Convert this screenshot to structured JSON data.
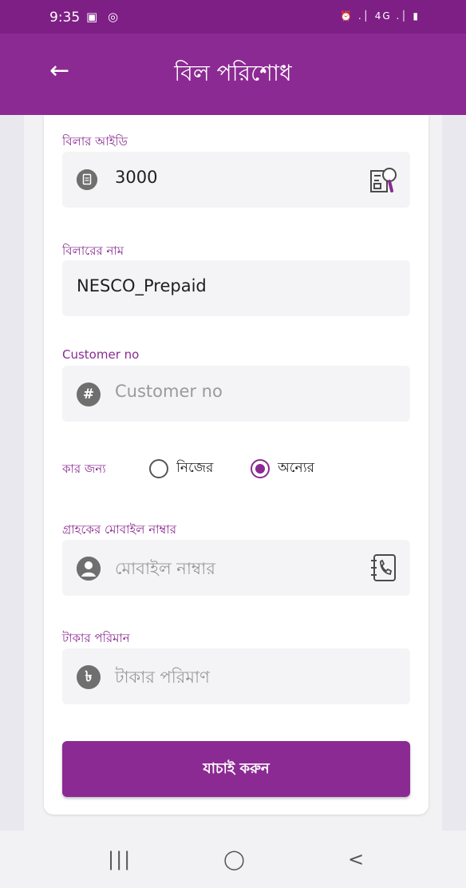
{
  "status": {
    "time": "9:35",
    "left_icons": "▣ ◎",
    "right_icons": "⏰ .│ 4G .│ ▮"
  },
  "appbar": {
    "back_icon": "arrow-left-icon",
    "title": "বিল পরিশোধ"
  },
  "form": {
    "biller_id": {
      "label": "বিলার আইডি",
      "value": "3000",
      "lead_icon": "document-icon",
      "action_icon": "search-document-icon"
    },
    "biller_name": {
      "label": "বিলারের নাম",
      "value": "NESCO_Prepaid"
    },
    "customer_no": {
      "label": "Customer no",
      "placeholder": "Customer no",
      "lead_icon": "hash-icon"
    },
    "for_whom": {
      "label": "কার জন্য",
      "options": [
        {
          "label": "নিজের",
          "selected": false
        },
        {
          "label": "অন্যের",
          "selected": true
        }
      ]
    },
    "customer_mobile": {
      "label": "গ্রাহকের মোবাইল নাম্বার",
      "placeholder": "মোবাইল নাম্বার",
      "lead_icon": "user-icon",
      "action_icon": "contact-book-icon"
    },
    "amount": {
      "label": "টাকার পরিমান",
      "placeholder": "টাকার পরিমাণ",
      "lead_icon": "taka-icon"
    },
    "verify_button": "যাচাই করুন"
  },
  "navbar": {
    "recents": "|||",
    "home": "◯",
    "back": "<"
  },
  "colors": {
    "primary": "#8c2a93",
    "status_bar": "#7e1f86",
    "label": "#8a2a91",
    "field_bg": "#f4f4f6"
  }
}
